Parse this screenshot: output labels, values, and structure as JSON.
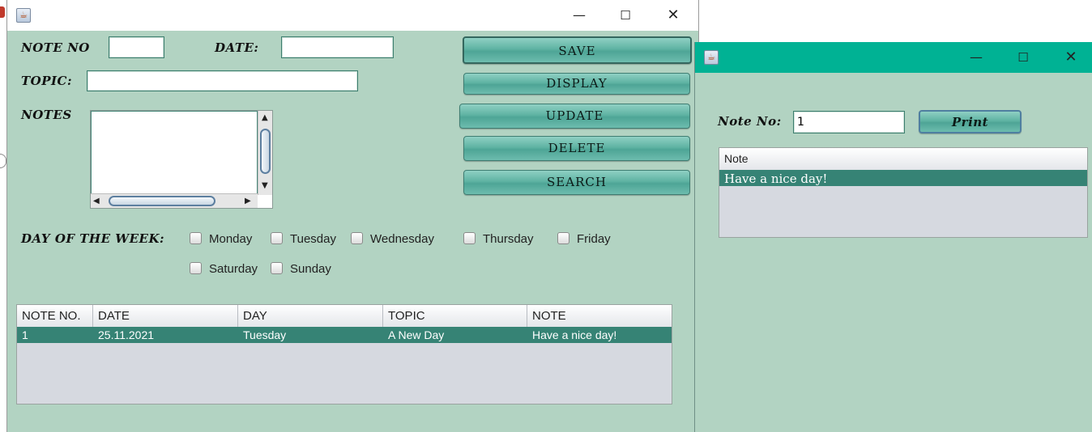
{
  "main_window": {
    "labels": {
      "note_no": "NOTE NO",
      "date": "DATE:",
      "topic": "TOPIC:",
      "notes": "NOTES",
      "day_of_week": "DAY OF THE WEEK:"
    },
    "fields": {
      "note_no": "",
      "date": "",
      "topic": "",
      "notes": ""
    },
    "buttons": {
      "save": "SAVE",
      "display": "DISPLAY",
      "update": "UPDATE",
      "delete": "DELETE",
      "search": "SEARCH"
    },
    "days": [
      "Monday",
      "Tuesday",
      "Wednesday",
      "Thursday",
      "Friday",
      "Saturday",
      "Sunday"
    ],
    "table": {
      "columns": [
        "NOTE NO.",
        "DATE",
        "DAY",
        "TOPIC",
        "NOTE"
      ],
      "rows": [
        [
          "1",
          "25.11.2021",
          "Tuesday",
          "A New Day",
          "Have a nice day!"
        ]
      ]
    }
  },
  "print_window": {
    "label": "Note No:",
    "note_no_value": "1",
    "print_button": "Print",
    "table": {
      "columns": [
        "Note"
      ],
      "rows": [
        [
          "Have a nice day!"
        ]
      ]
    }
  },
  "colors": {
    "panel_bg": "#b2d3c2",
    "selected_row": "#368375",
    "titlebar_active": "#00b294"
  }
}
